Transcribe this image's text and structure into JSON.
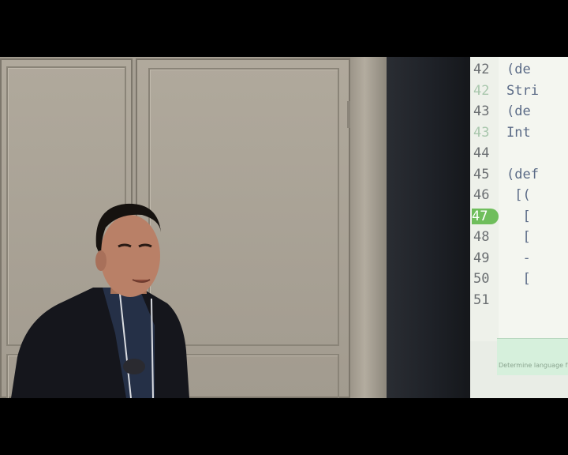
{
  "screen": {
    "lines": [
      {
        "number": "42",
        "code": "(de"
      },
      {
        "number": "42",
        "code": "Stri",
        "dim": true
      },
      {
        "number": "43",
        "code": "(de"
      },
      {
        "number": "43",
        "code": "Int",
        "dim": true
      },
      {
        "number": "44",
        "code": ""
      },
      {
        "number": "45",
        "code": "(def"
      },
      {
        "number": "46",
        "code": " [("
      },
      {
        "number": "47",
        "code": "  [",
        "active": true
      },
      {
        "number": "48",
        "code": "  ["
      },
      {
        "number": "49",
        "code": "  -"
      },
      {
        "number": "50",
        "code": "  ["
      },
      {
        "number": "51",
        "code": ""
      }
    ],
    "status_text": "Determine language from"
  },
  "colors": {
    "wall": "#a8a195",
    "screen_bg": "#f4f6f0",
    "active_line": "#6fbe5c",
    "jacket": "#15161c"
  }
}
